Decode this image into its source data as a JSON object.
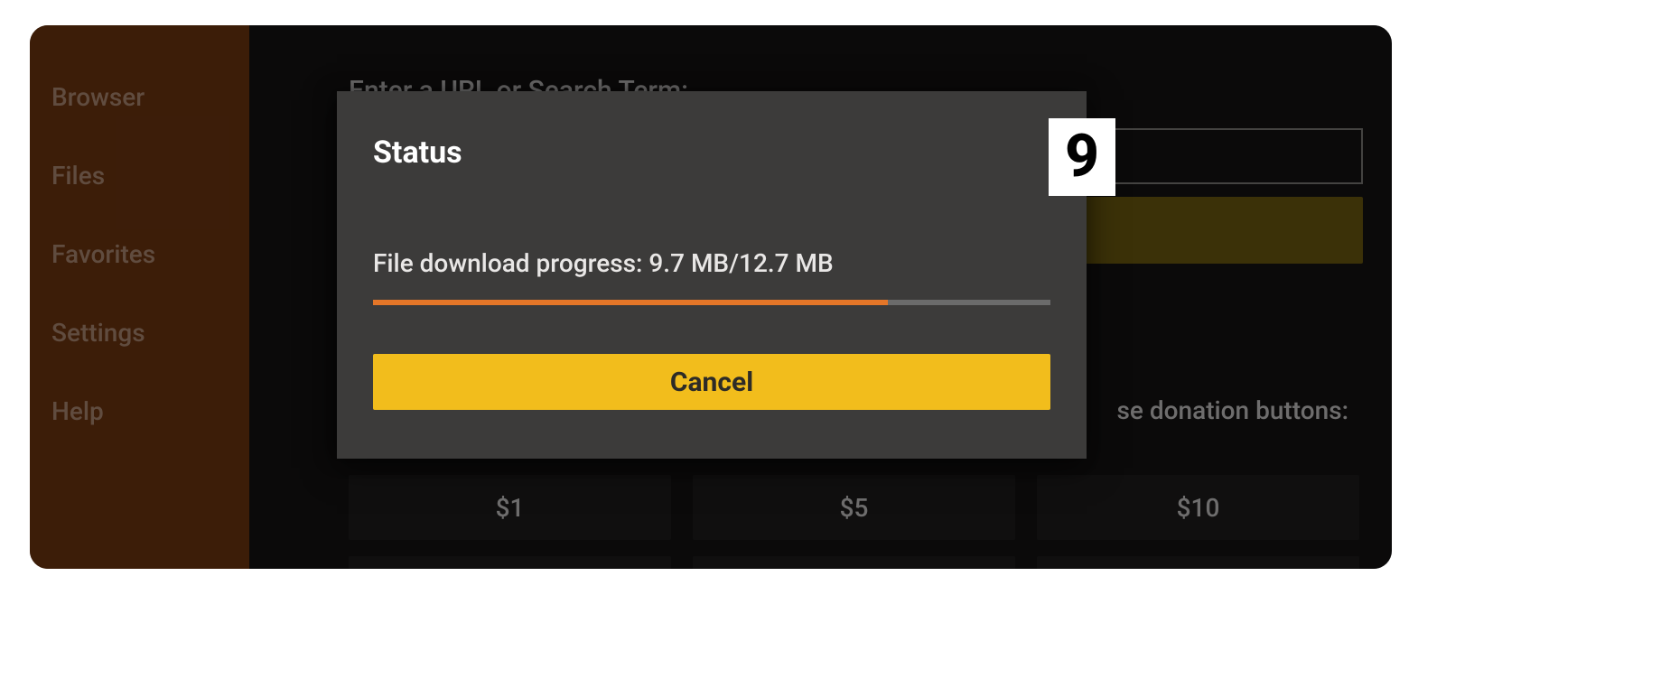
{
  "sidebar": {
    "items": [
      {
        "label": "Browser"
      },
      {
        "label": "Files"
      },
      {
        "label": "Favorites"
      },
      {
        "label": "Settings"
      },
      {
        "label": "Help"
      }
    ]
  },
  "main": {
    "prompt": "Enter a URL or Search Term:",
    "donation_text": "se donation buttons:",
    "donations": [
      "$1",
      "$5",
      "$10"
    ]
  },
  "modal": {
    "title": "Status",
    "progress_label": "File download progress: 9.7 MB/12.7 MB",
    "progress_downloaded_mb": 9.7,
    "progress_total_mb": 12.7,
    "progress_percent": 76,
    "cancel_label": "Cancel"
  },
  "step_badge": "9",
  "colors": {
    "sidebar_bg": "#6e3510",
    "modal_bg": "#3c3b3a",
    "progress_fill": "#e47628",
    "accent_yellow": "#f2bd1c"
  }
}
